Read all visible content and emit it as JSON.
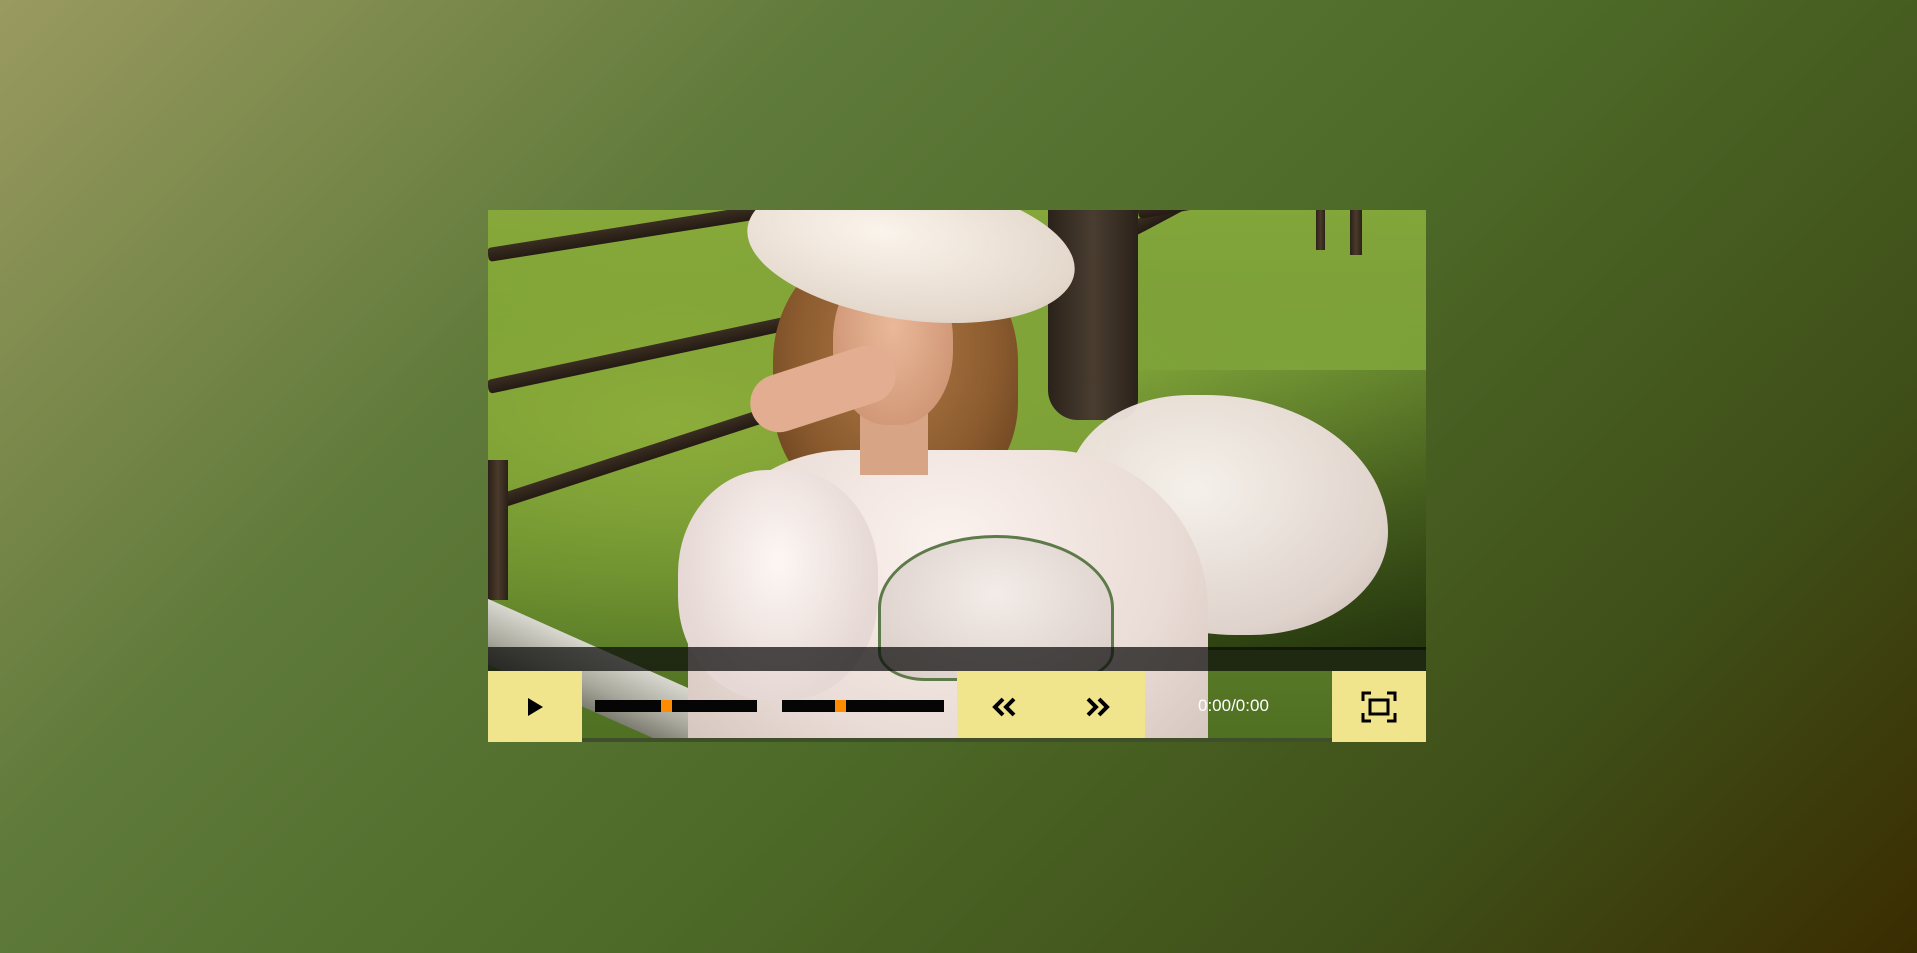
{
  "player": {
    "time_display": "0:00/0:00",
    "progress_fraction": 0.44,
    "volume_fraction": 0.35,
    "accent_color": "#ff8c00",
    "button_color": "#f0e58c"
  },
  "controls": {
    "play_icon": "play-icon",
    "rewind_icon": "rewind-icon",
    "forward_icon": "fast-forward-icon",
    "fullscreen_icon": "fullscreen-icon"
  },
  "video": {
    "poster_description_icon": "video-poster"
  }
}
